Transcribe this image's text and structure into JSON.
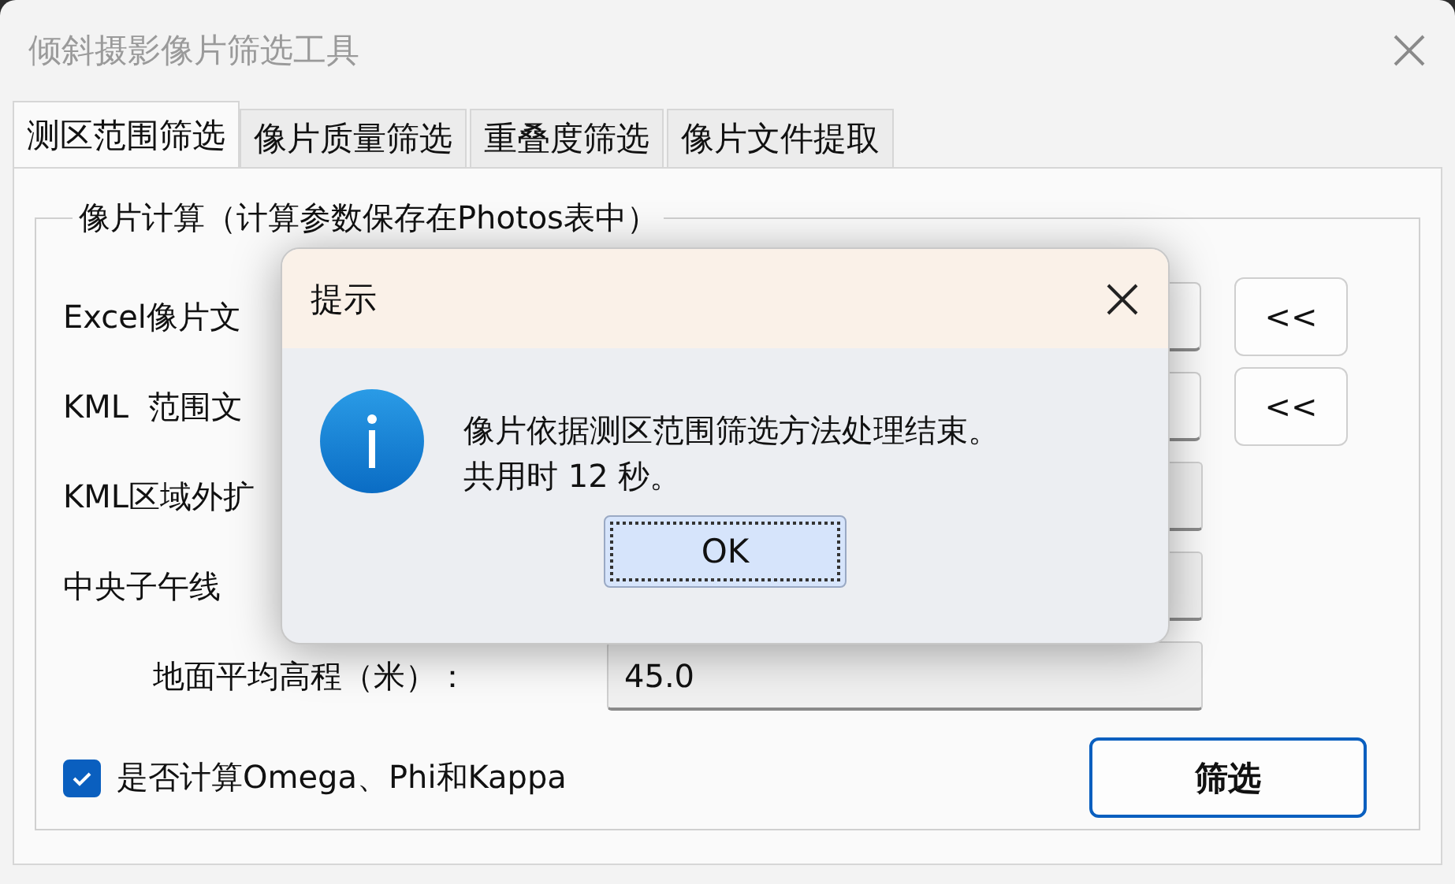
{
  "window": {
    "title": "倾斜摄影像片筛选工具"
  },
  "tabs": [
    {
      "label": "测区范围筛选",
      "selected": true
    },
    {
      "label": "像片质量筛选",
      "selected": false
    },
    {
      "label": "重叠度筛选",
      "selected": false
    },
    {
      "label": "像片文件提取",
      "selected": false
    }
  ],
  "group": {
    "title": "像片计算（计算参数保存在Photos表中）",
    "rows": [
      {
        "kind": "file",
        "label": "Excel像片文",
        "action": "<<"
      },
      {
        "kind": "file",
        "label": "KML  范围文",
        "action": "<<"
      },
      {
        "kind": "field",
        "label": "KML区域外扩"
      },
      {
        "kind": "field",
        "label": "中央子午线"
      },
      {
        "kind": "sub-field",
        "label": "地面平均高程（米）：",
        "value": "45.0"
      }
    ]
  },
  "checkbox": {
    "label": "是否计算Omega、Phi和Kappa",
    "checked": true
  },
  "filter_button": "筛选",
  "dialog": {
    "title": "提示",
    "message": [
      "像片依据测区范围筛选方法处理结束。",
      "共用时 12 秒。"
    ],
    "ok": "OK"
  }
}
